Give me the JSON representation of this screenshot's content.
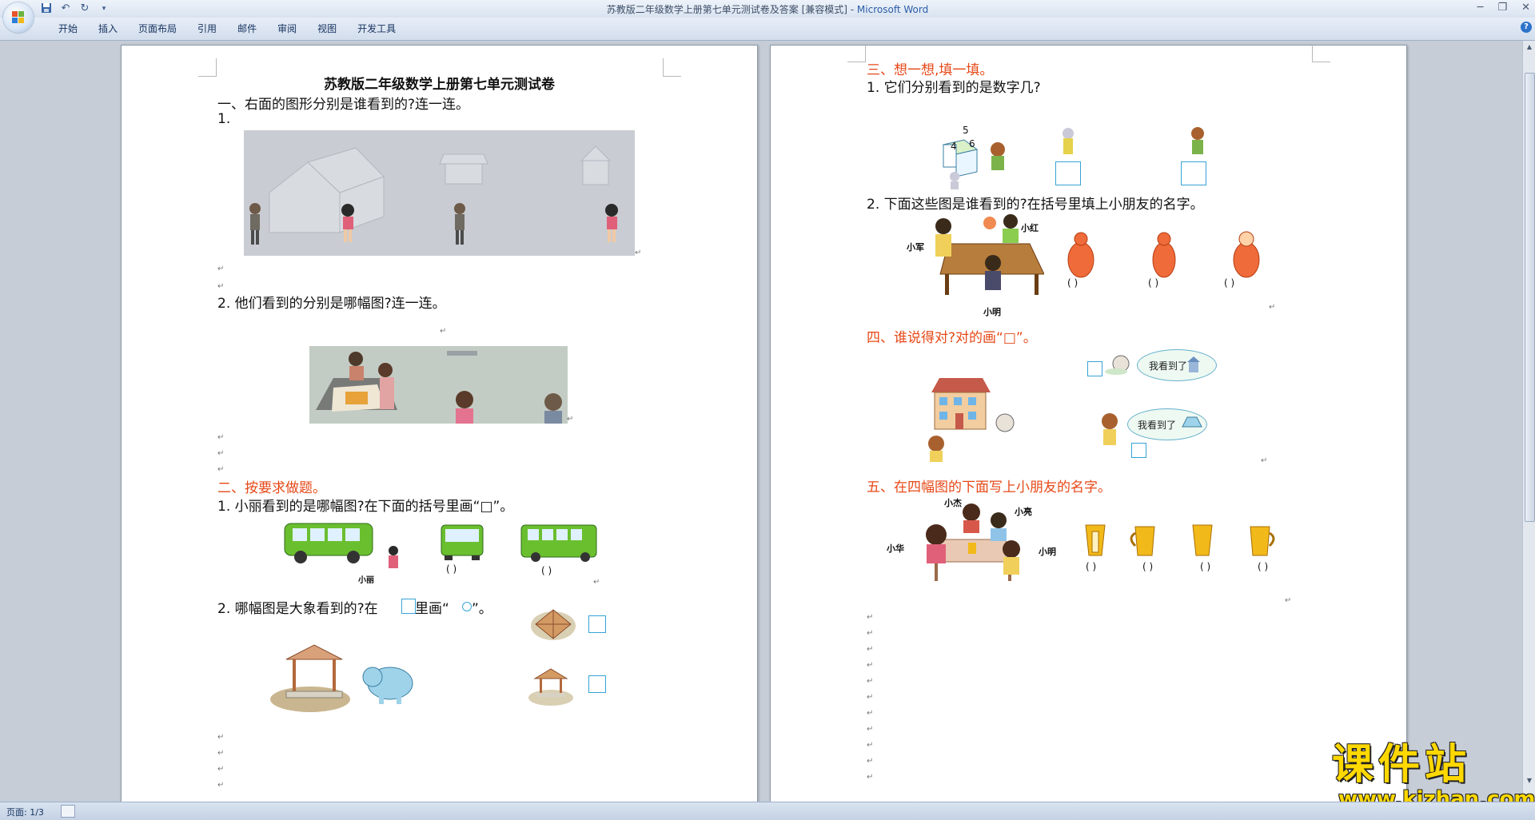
{
  "window": {
    "title": "苏教版二年级数学上册第七单元测试卷及答案 [兼容模式] - ",
    "app_name": "Microsoft Word"
  },
  "ribbon_tabs": [
    "开始",
    "插入",
    "页面布局",
    "引用",
    "邮件",
    "审阅",
    "视图",
    "开发工具"
  ],
  "status": {
    "page": "页面: 1/3"
  },
  "page1": {
    "title": "苏教版二年级数学上册第七单元测试卷",
    "s1_heading": "一、右面的图形分别是谁看到的?连一连。",
    "s1_q1": "1.",
    "s1_q2": "2. 他们看到的分别是哪幅图?连一连。",
    "s2_heading": "二、按要求做题。",
    "s2_q1": "1. 小丽看到的是哪幅图?在下面的括号里画“□”。",
    "s2_q1_name": "小丽",
    "s2_q2_a": "2.  哪幅图是大象看到的?在",
    "s2_q2_b": "里画“",
    "s2_q2_c": "”。",
    "paren": "(        )"
  },
  "page2": {
    "s3_heading": "三、想一想,填一填。",
    "s3_q1": "1. 它们分别看到的是数字几?",
    "dice_numbers": [
      "5",
      "4",
      "6"
    ],
    "s3_q2": "2.  下面这些图是谁看到的?在括号里填上小朋友的名字。",
    "names_q2": [
      "小军",
      "小红",
      "小明"
    ],
    "s4_heading": "四、谁说得对?对的画“□”。",
    "bubble_text": "我看到了",
    "s5_heading": "五、在四幅图的下面写上小朋友的名字。",
    "names_q5": [
      "小杰",
      "小亮",
      "小华",
      "小明"
    ],
    "paren": "(     )"
  },
  "watermark": {
    "cn": "课件站",
    "en": "www.kjzhan.com"
  },
  "colors": {
    "heading_red": "#e64817",
    "box_blue": "#36a3d6",
    "bus_green": "#6abf2f",
    "cup_yellow": "#f2b91a"
  }
}
